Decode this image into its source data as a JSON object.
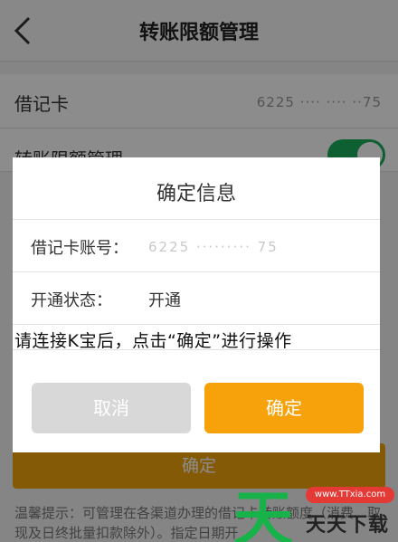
{
  "nav": {
    "title": "转账限额管理"
  },
  "card_row": {
    "label": "借记卡",
    "value": "6225 ···· ···· ··75"
  },
  "limit_row": {
    "label": "转账限额管理"
  },
  "bottom_button": {
    "label": "确定"
  },
  "tip": {
    "text": "温馨提示：可管理在各渠道办理的借记卡转账额度（消费、取现及日终批量扣款除外）。指定日期开"
  },
  "dialog": {
    "title": "确定信息",
    "card_label": "借记卡账号：",
    "card_value": "6225 ········· 75",
    "status_label": "开通状态：",
    "status_value": "开通",
    "notice": "请连接K宝后，点击“确定”进行操作",
    "cancel_label": "取消",
    "confirm_label": "确定"
  },
  "watermark": {
    "big": "天",
    "pill": "www.TTxia.com",
    "text": "天天下载"
  },
  "colors": {
    "accent": "#f7a20a",
    "toggle_on": "#1aad5c",
    "cancel_bg": "#d8d8d8"
  }
}
